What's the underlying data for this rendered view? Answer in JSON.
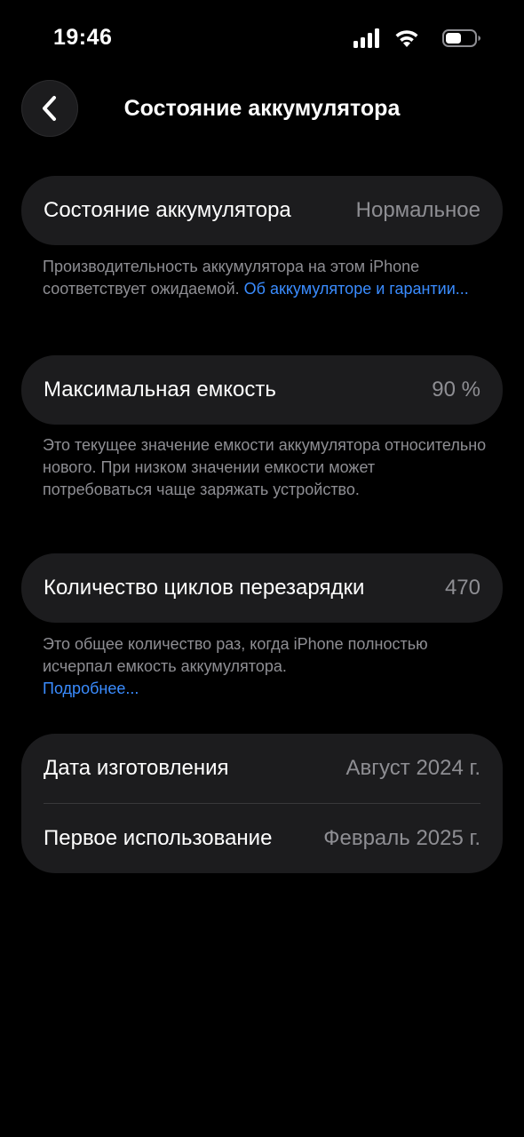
{
  "status_bar": {
    "time": "19:46"
  },
  "header": {
    "title": "Состояние аккумулятора"
  },
  "battery_health": {
    "label": "Состояние аккумулятора",
    "value": "Нормальное",
    "footnote": "Производительность аккумулятора на этом iPhone соответствует ожидаемой.",
    "link": "Об аккумуляторе и гарантии..."
  },
  "max_capacity": {
    "label": "Максимальная емкость",
    "value": "90 %",
    "footnote": "Это текущее значение емкости аккумулятора относительно нового. При низком значении емкости может потребоваться чаще заряжать устройство."
  },
  "cycle_count": {
    "label": "Количество циклов перезарядки",
    "value": "470",
    "footnote": "Это общее количество раз, когда iPhone полностью исчерпал емкость аккумулятора.",
    "link": "Подробнее..."
  },
  "dates": {
    "manufacture_label": "Дата изготовления",
    "manufacture_value": "Август 2024 г.",
    "first_use_label": "Первое использование",
    "first_use_value": "Февраль 2025 г."
  },
  "icons": [
    "signal-icon",
    "wifi-icon",
    "battery-icon",
    "chevron-left-icon"
  ],
  "colors": {
    "background": "#000000",
    "card": "#1c1c1e",
    "secondary_text": "#8e8e93",
    "link": "#3a8cff"
  }
}
